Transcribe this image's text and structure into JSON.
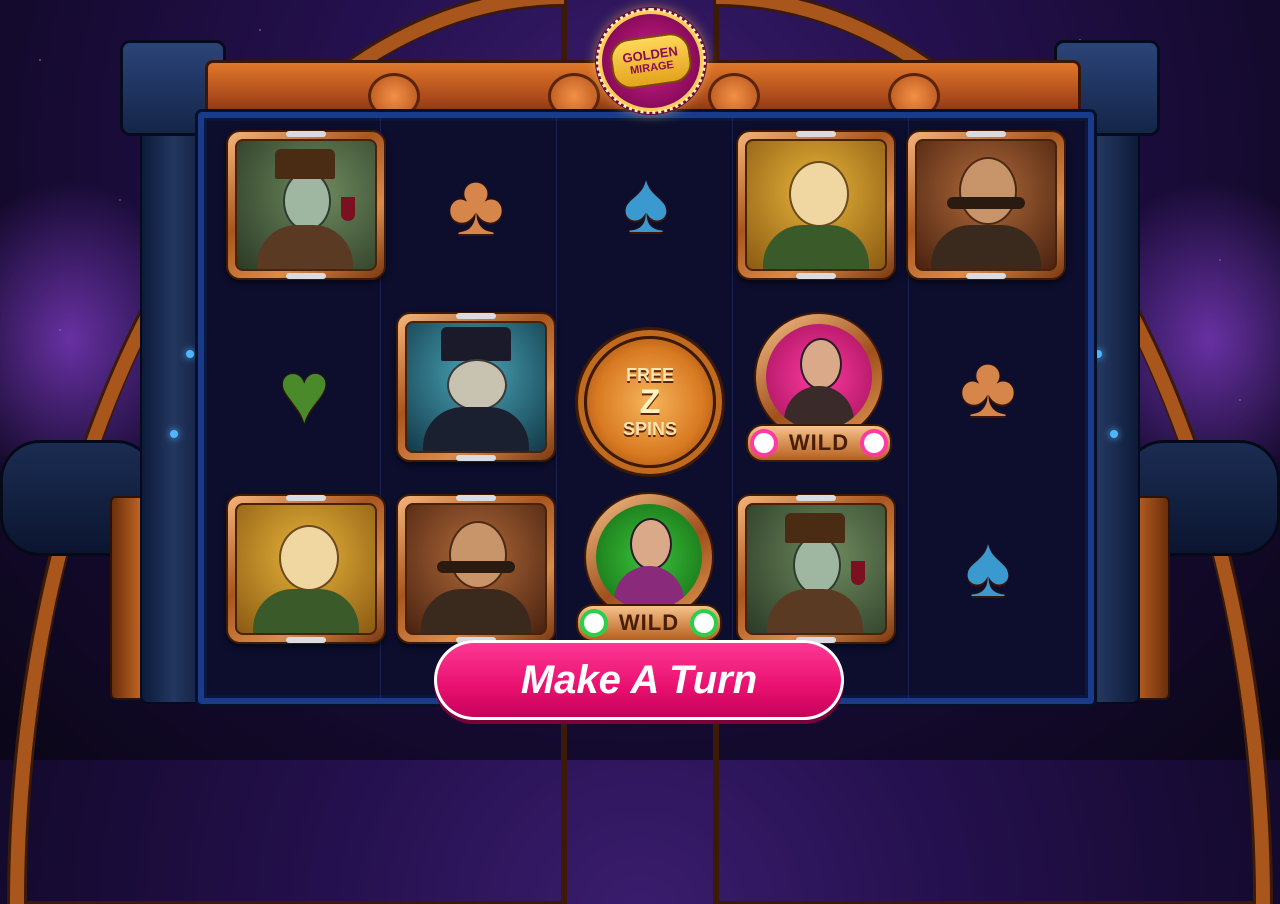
{
  "game": {
    "logo": {
      "line1": "GOLDEN",
      "line2": "MIRAGE"
    },
    "free_spins": {
      "top": "FREE",
      "mid": "Z",
      "bottom": "SPINS"
    },
    "wild_label": "WILD",
    "action_button": "Make A Turn",
    "colors": {
      "accent": "#e8106f",
      "frame": "#1a3a8a",
      "copper": "#c06a1f"
    },
    "reels": [
      [
        "robot-gentleman-icon",
        "heart-suit-icon",
        "sphynx-cat-icon"
      ],
      [
        "club-suit-icon",
        "plague-doctor-icon",
        "mustache-baron-icon"
      ],
      [
        "spade-suit-icon",
        "free-spins-icon",
        "wild-lady-green-icon"
      ],
      [
        "sphynx-cat-icon",
        "wild-lady-pink-icon",
        "robot-gentleman-icon"
      ],
      [
        "mustache-baron-icon",
        "club-suit-icon",
        "spade-suit-icon"
      ]
    ]
  }
}
